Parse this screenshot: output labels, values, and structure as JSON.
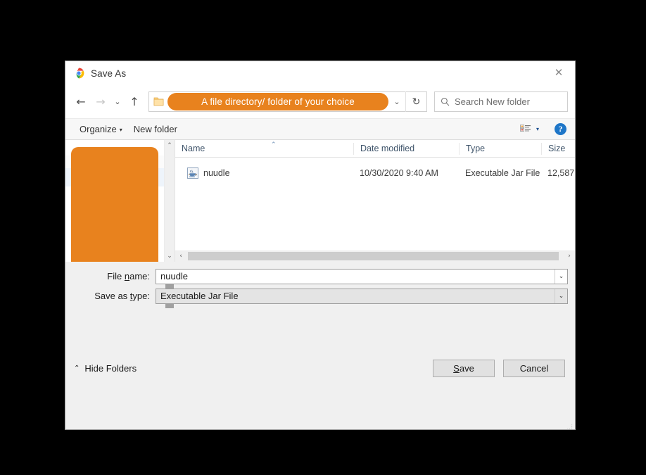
{
  "window": {
    "title": "Save As",
    "app_icon": "chrome-icon",
    "close_label": "✕"
  },
  "nav": {
    "back": "←",
    "forward": "→",
    "history": "⌄",
    "up": "↑",
    "refresh": "↻",
    "dropdown": "⌄"
  },
  "address": {
    "path_text": "A file directory/ folder of your choice",
    "folder_icon": "folder-icon",
    "highlight_color": "#e8821e"
  },
  "search": {
    "placeholder": "Search New folder",
    "icon": "search-icon"
  },
  "toolbar": {
    "organize_label": "Organize",
    "organize_caret": "▾",
    "new_folder_label": "New folder",
    "view_icon": "view-layout-icon",
    "view_caret": "▾",
    "help_label": "?"
  },
  "sidebar": {
    "overlay_color": "#e8821e",
    "scrollbar": {
      "up": "⌃",
      "down": "⌄"
    }
  },
  "filelist": {
    "columns": [
      {
        "label": "Name"
      },
      {
        "label": "Date modified"
      },
      {
        "label": "Type"
      },
      {
        "label": "Size"
      }
    ],
    "sort_marker": "⌃",
    "rows": [
      {
        "icon": "jar-file-icon",
        "name": "nuudle",
        "date_modified": "10/30/2020 9:40 AM",
        "type": "Executable Jar File",
        "size": "12,587"
      }
    ],
    "hscroll": {
      "left": "‹",
      "right": "›"
    }
  },
  "form": {
    "file_name": {
      "label_pre": "File ",
      "label_acc": "n",
      "label_post": "ame:",
      "value": "nuudle",
      "caret": "⌄"
    },
    "save_as_type": {
      "label_pre": "Save as ",
      "label_acc": "t",
      "label_post": "ype:",
      "value": "Executable Jar File",
      "caret": "⌄"
    }
  },
  "footer": {
    "hide_folders_chevron": "⌃",
    "hide_folders_label": "Hide Folders",
    "save": {
      "pre": "",
      "acc": "S",
      "post": "ave"
    },
    "cancel_label": "Cancel"
  },
  "background": {
    "ghost_text": " "
  }
}
